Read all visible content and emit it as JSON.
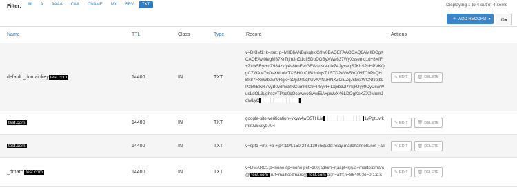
{
  "filter": {
    "label": "Filter:",
    "options": [
      "All",
      "A",
      "AAAA",
      "CAA",
      "CNAME",
      "MX",
      "SRV",
      "TXT"
    ],
    "active": "TXT"
  },
  "count_text": "Displaying 1 to 4 out of 4 items",
  "toolbar": {
    "add_label": "ADD RECORD",
    "add_icon": "plus-icon",
    "caret_icon": "caret-down-icon",
    "settings_icon": "gear-icon"
  },
  "columns": {
    "name": "Name",
    "ttl": "TTL",
    "class": "Class",
    "type": "Type",
    "record": "Record",
    "actions": "Actions"
  },
  "colors": {
    "accent": "#3a85c9",
    "link": "#2f7bc0"
  },
  "rows": [
    {
      "name_prefix": "default._domainkey",
      "name_redacted": "test.com",
      "ttl": "14400",
      "class": "IN",
      "type": "TXT",
      "record": "v=DKIM1; k=rsa; p=MIIBIjANBgkqhkiG9w0BAQEFAAOCAQ8AMIIBCgKCAQEAvl0legM87KrTtjm3hD1cfi5DbDOByXWa637WyXssemq1d+8XfFr+Ztdx5Ry/+dZ984zv/y4v8hnFerGEWsusc4dIxZ4Jy+wqSJKhS2nHPVKQgC7WAM7vOsX6LoMTXt5H0pClBUx0qsTjL5TD2eVw5/rQJ97C9PkQHBk87FXkWb0vn9RgkFaOjv9n0qhUvXANuRNXZGluZqJsfw3WCNfJpjbLPzb0iBKR7VyB0vdmsBNCumk6C9FP8yvI+jLxjxb3JPYkjkUyy9CyDswWusLdOL3ughezvTPpq0cOcowwcGwwEiA+pWvX46LDOgKeKZX0MumJqWLyC",
      "record_redacted": "████████████"
    },
    {
      "name_prefix": "",
      "name_redacted": "test.com",
      "ttl": "14400",
      "class": "IN",
      "type": "TXT",
      "record": "google-site-verification=yxyw4wD5THUa",
      "record_redacted": "████████████",
      "record_suffix": "1yPgtUwkm80Z5vsyb704"
    },
    {
      "name_prefix": "",
      "name_redacted": "test.com",
      "ttl": "14400",
      "class": "IN",
      "type": "TXT",
      "record": "v=spf1 +mx +a +ip4:194.150.248.139 include:relay.mailchannels.net ~all"
    },
    {
      "name_prefix": "_dmarc.",
      "name_redacted": "test.com",
      "ttl": "14400",
      "class": "IN",
      "type": "TXT",
      "record": "v=DMARC1;p=none;sp=none;pct=100;adkim=r;aspf=r;rua=mailto:dmarc@",
      "record_redacted": "test.com",
      "record_mid": ";ruf=mailto:dmarc@",
      "record_redacted2": "test.com",
      "record_suffix": "al;rf=afrf;ri=86400;fo=0:1:d:s"
    }
  ],
  "row_actions": {
    "edit": "EDIT",
    "delete": "DELETE",
    "edit_icon": "pencil-icon",
    "delete_icon": "trash-icon"
  }
}
